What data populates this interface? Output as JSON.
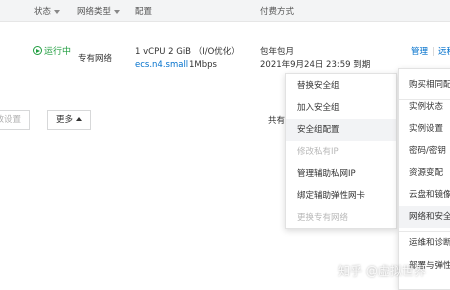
{
  "header": {
    "status": "状态",
    "network_type": "网络类型",
    "config": "配置",
    "billing": "付费方式"
  },
  "instance": {
    "status_text": "运行中",
    "network": "专有网络",
    "spec": "1 vCPU 2 GiB （I/O优化）",
    "instance_type": "ecs.n4.small",
    "bandwidth": "1Mbps",
    "billing_type": "包年包月",
    "expire": "2021年9月24日 23:59 到期",
    "action_manage": "管理",
    "action_separator": "|",
    "action_remote": "远程"
  },
  "toolbar": {
    "release_settings": "释放设置",
    "more": "更多",
    "total_prefix": "共有"
  },
  "more_menu": {
    "items": [
      {
        "label": "替换安全组",
        "state": "normal"
      },
      {
        "label": "加入安全组",
        "state": "normal"
      },
      {
        "label": "安全组配置",
        "state": "hover"
      },
      {
        "label": "修改私有IP",
        "state": "disabled"
      },
      {
        "label": "管理辅助私网IP",
        "state": "normal"
      },
      {
        "label": "绑定辅助弹性网卡",
        "state": "normal"
      },
      {
        "label": "更换专有网络",
        "state": "disabled"
      }
    ]
  },
  "side_menu": {
    "items": [
      {
        "label": "购买相同配置"
      },
      {
        "label": "实例状态"
      },
      {
        "label": "实例设置"
      },
      {
        "label": "密码/密钥"
      },
      {
        "label": "资源变配"
      },
      {
        "label": "云盘和镜像"
      },
      {
        "label": "网络和安全组"
      },
      {
        "label": "运维和诊断"
      },
      {
        "label": "部署与弹性"
      }
    ]
  },
  "watermark": "知乎 @虚拟世界"
}
